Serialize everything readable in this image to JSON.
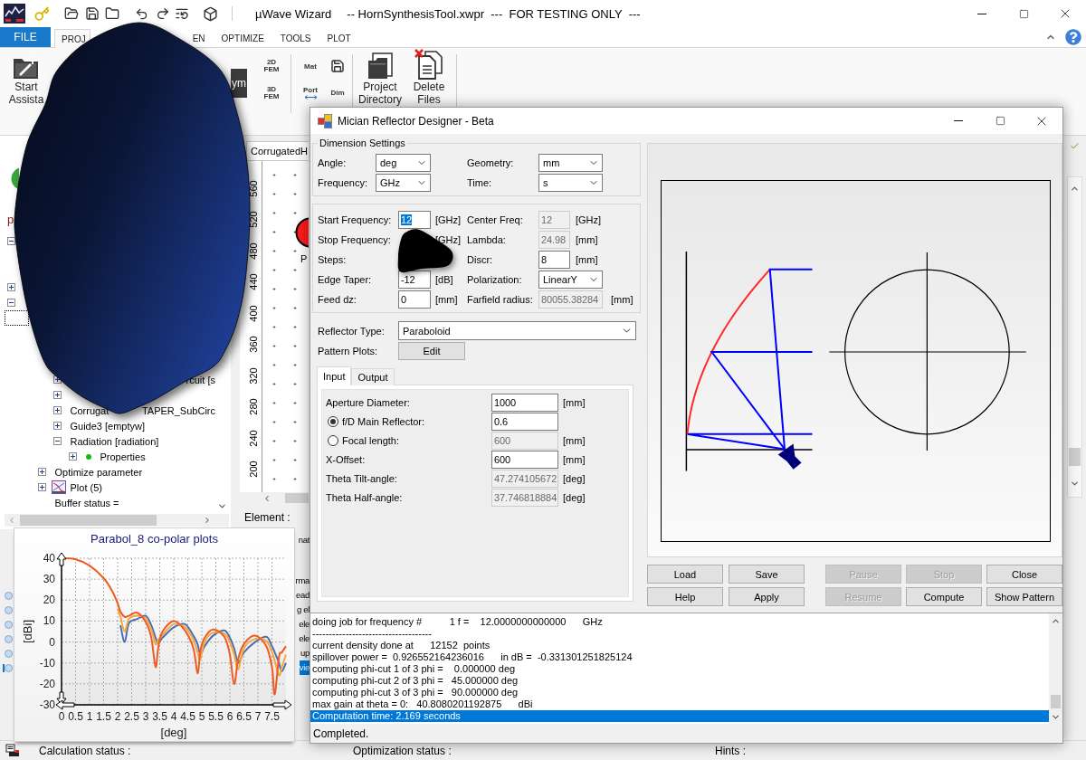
{
  "window": {
    "app_name": "µWave Wizard",
    "title": "-- HornSynthesisTool.xwpr  ---  FOR TESTING ONLY  ---"
  },
  "ribbon_tabs": [
    {
      "kind": "file",
      "label": "FILE",
      "selected": false
    },
    {
      "kind": "tab",
      "label": "PROJ",
      "selected": true
    },
    {
      "kind": "tab",
      "label": "EN",
      "selected": false
    },
    {
      "kind": "tab",
      "label": "OPTIMIZE",
      "selected": false
    },
    {
      "kind": "tab",
      "label": "TOOLS",
      "selected": false
    },
    {
      "kind": "tab",
      "label": "PLOT",
      "selected": false
    }
  ],
  "ribbon": {
    "start": {
      "lines": [
        "Start",
        "Assista"
      ]
    },
    "tile": "ym",
    "fem": [
      {
        "lines": [
          "2D",
          "FEM"
        ]
      },
      {
        "lines": [
          "3D",
          "FEM"
        ]
      }
    ],
    "small": [
      {
        "kind": "text",
        "label": "Mat"
      },
      {
        "kind": "disk"
      },
      {
        "kind": "port",
        "label": "Port"
      },
      {
        "kind": "text",
        "label": "Dim"
      }
    ],
    "large": [
      {
        "kind": "folder",
        "lines": [
          "Project",
          "Directory"
        ]
      },
      {
        "kind": "delete",
        "lines": [
          "Delete",
          "Files"
        ]
      }
    ]
  },
  "tree": {
    "header": "p",
    "nodes": [
      {
        "expanded": true
      },
      {
        "expanded": false
      },
      {
        "expanded": true,
        "children": [
          {
            "focused": true,
            "children": [
              {
                "children": [
                  {
                    "kind": "tail",
                    "label": "rcuit [s",
                    "expanded": false
                  },
                  {
                    "expanded": false
                  },
                  {
                    "kind": "split",
                    "label": "Corrugat",
                    "tail": "TAPER_SubCirc",
                    "expanded": false
                  },
                  {
                    "label": "Guide3 [emptyw]",
                    "expanded": false
                  },
                  {
                    "label": "Radiation [radiation]",
                    "expanded": true,
                    "children": [
                      {
                        "kind": "dot",
                        "label": "Properties",
                        "expanded": false
                      }
                    ]
                  }
                ]
              },
              {
                "label": "Optimize parameter",
                "expanded": false
              },
              {
                "kind": "plot",
                "label": "Plot (5)",
                "expanded": false
              },
              {
                "label": "Buffer status ="
              }
            ]
          }
        ]
      }
    ]
  },
  "canvas": {
    "tab": "CorrugatedH",
    "ruler": [
      "560",
      "520",
      "480",
      "440",
      "400",
      "360",
      "320",
      "280",
      "240",
      "200"
    ],
    "node_label": "P",
    "element_label": "Element :"
  },
  "lower_panel": {
    "headers": [
      "nat",
      "rma"
    ],
    "rows": [
      {
        "selected": false,
        "text": "ead"
      },
      {
        "selected": false,
        "text": "g el"
      },
      {
        "selected": false,
        "text": "ele"
      },
      {
        "selected": false,
        "text": "ele"
      },
      {
        "selected": false,
        "text": "up"
      },
      {
        "selected": true,
        "text": "vie"
      }
    ]
  },
  "plot_window": {
    "chart_data": {
      "type": "line",
      "title": "Parabol_8 co-polar plots",
      "xlabel": "[deg]",
      "ylabel": "[dBi]",
      "grid": true,
      "x": [
        0,
        0.5,
        1,
        1.5,
        1.8,
        2,
        2.1,
        2.25,
        2.4,
        2.7,
        3,
        3.2,
        3.35,
        3.45,
        3.6,
        4,
        4.4,
        4.7,
        4.85,
        4.95,
        5.1,
        5.4,
        5.8,
        6,
        6.15,
        6.3,
        6.5,
        6.9,
        7.3,
        7.5,
        7.6,
        7.75,
        7.85,
        8
      ],
      "series": [
        {
          "color": "#4a6fae",
          "values": [
            null,
            null,
            null,
            null,
            null,
            null,
            8,
            0,
            9,
            11,
            12.5,
            8,
            2,
            -0.5,
            2,
            7,
            8.5,
            3,
            -1,
            -6,
            -2,
            3,
            5.5,
            2,
            -3,
            -10,
            -5,
            0,
            2.5,
            -2,
            -5,
            -10,
            -14,
            -10
          ]
        },
        {
          "color": "#f4a742",
          "values": [
            null,
            null,
            null,
            null,
            null,
            16,
            12,
            5,
            11,
            12.5,
            11,
            6,
            -1,
            1,
            3.5,
            8.5,
            7,
            1,
            -5,
            -8,
            0,
            4.5,
            4,
            0,
            -6,
            -13,
            -3,
            1.5,
            0.5,
            -5,
            -9,
            -16,
            -12,
            -6
          ]
        },
        {
          "color": "#f05a23",
          "values": [
            40,
            39.5,
            36.5,
            30.5,
            24.5,
            18.5,
            14.5,
            12,
            12.5,
            14,
            9.5,
            2,
            -12,
            -2.5,
            5,
            10,
            5.5,
            -3,
            -15,
            -4,
            2,
            6,
            2.5,
            -6,
            -20,
            -8,
            -1,
            3,
            -2,
            -12,
            -25,
            -7,
            -5,
            -2
          ]
        }
      ],
      "xlim": [
        0,
        8
      ],
      "ylim": [
        -30,
        40
      ],
      "xticks": [
        0,
        0.5,
        1,
        1.5,
        2,
        2.5,
        3,
        3.5,
        4,
        4.5,
        5,
        5.5,
        6,
        6.5,
        7,
        7.5
      ],
      "yticks": [
        -30,
        -20,
        -10,
        0,
        10,
        20,
        30,
        40
      ]
    }
  },
  "dialog": {
    "title": "Mician Reflector Designer - Beta",
    "dimension_settings": {
      "title": "Dimension Settings",
      "rows": [
        [
          {
            "label": "Angle:",
            "value": "deg"
          },
          {
            "label": "Geometry:",
            "value": "mm"
          }
        ],
        [
          {
            "label": "Frequency:",
            "value": "GHz"
          },
          {
            "label": "Time:",
            "value": "s"
          }
        ]
      ]
    },
    "parameters": [
      [
        {
          "label": "Start Frequency:",
          "kind": "input",
          "disabled": false,
          "value": "12",
          "highlighted": true,
          "unit": "[GHz]"
        },
        {
          "label": "Center Freq:",
          "kind": "input",
          "disabled": true,
          "value": "12",
          "unit": "[GHz]"
        }
      ],
      [
        {
          "label": "Stop Frequency:",
          "unit": "[GHz]"
        },
        {
          "label": "Lambda:",
          "kind": "input",
          "disabled": true,
          "value": "24.98",
          "unit": "[mm]"
        }
      ],
      [
        {
          "label": "Steps:"
        },
        {
          "label": "Discr:",
          "kind": "input",
          "disabled": false,
          "value": "8",
          "highlighted": false,
          "unit": "[mm]"
        }
      ],
      [
        {
          "label": "Edge Taper:",
          "kind": "input",
          "disabled": false,
          "value": "-12",
          "highlighted": false,
          "unit": "[dB]"
        },
        {
          "label": "Polarization:",
          "kind": "select",
          "value": "LinearY"
        }
      ],
      [
        {
          "label": "Feed dz:",
          "kind": "input",
          "disabled": false,
          "value": "0",
          "highlighted": false,
          "unit": "[mm]"
        },
        {
          "label": "Farfield radius:",
          "kind": "input",
          "disabled": true,
          "value": "80055.38284",
          "unit": "[mm]"
        }
      ]
    ],
    "reflector_type": {
      "label": "Reflector Type:",
      "value": "Paraboloid"
    },
    "pattern_plots": {
      "label": "Pattern Plots:",
      "button": "Edit"
    },
    "tabs": [
      {
        "label": "Input",
        "selected": true
      },
      {
        "label": "Output",
        "selected": false
      }
    ],
    "input_rows": [
      {
        "label": "Aperture Diameter:",
        "kind": "input",
        "disabled": false,
        "value": "1000",
        "unit": "[mm]"
      },
      {
        "selected": true,
        "label": "f/D Main Reflector:",
        "kind": "input",
        "disabled": false,
        "value": "0.6"
      },
      {
        "selected": false,
        "label": "Focal length:",
        "kind": "input",
        "disabled": true,
        "value": "600",
        "unit": "[mm]"
      },
      {
        "label": "X-Offset:",
        "kind": "input",
        "disabled": false,
        "value": "600",
        "unit": "[mm]"
      },
      {
        "label": "Theta Tilt-angle:",
        "kind": "input",
        "disabled": true,
        "value": "47.274105672",
        "unit": "[deg]"
      },
      {
        "label": "Theta Half-angle:",
        "kind": "input",
        "disabled": true,
        "value": "37.746818884",
        "unit": "[deg]"
      }
    ],
    "buttons": [
      {
        "label": "Load",
        "disabled": false
      },
      {
        "label": "Save",
        "disabled": false
      },
      {
        "label": "Pause",
        "disabled": true
      },
      {
        "label": "Stop",
        "disabled": true
      },
      {
        "label": "Close",
        "disabled": false
      },
      {
        "label": "Help",
        "disabled": false
      },
      {
        "label": "Apply",
        "disabled": false
      },
      {
        "label": "Resume",
        "disabled": true
      },
      {
        "label": "Compute",
        "disabled": false
      },
      {
        "label": "Show Pattern",
        "disabled": false
      }
    ],
    "log": [
      {
        "text": "doing job for frequency #          1 f =    12.0000000000000      GHz",
        "selected": false
      },
      {
        "text": "------------------------------------",
        "selected": false
      },
      {
        "text": "current density done at      12152  points",
        "selected": false
      },
      {
        "text": "spillover power =  0.926552164236016      in dB =  -0.331301251825124",
        "selected": false
      },
      {
        "text": "computing phi-cut 1 of 3 phi =    0.000000 deg",
        "selected": false
      },
      {
        "text": "computing phi-cut 2 of 3 phi =   45.000000 deg",
        "selected": false
      },
      {
        "text": "computing phi-cut 3 of 3 phi =   90.000000 deg",
        "selected": false
      },
      {
        "text": "max gain at theta = 0:   40.8080201192875      dBi",
        "selected": false
      },
      {
        "text": "Computation time: 2.169 seconds",
        "selected": true
      }
    ],
    "status": "Completed."
  },
  "status_bar": {
    "items": [
      "Calculation status :",
      "Optimization status :",
      "Hints :"
    ]
  }
}
